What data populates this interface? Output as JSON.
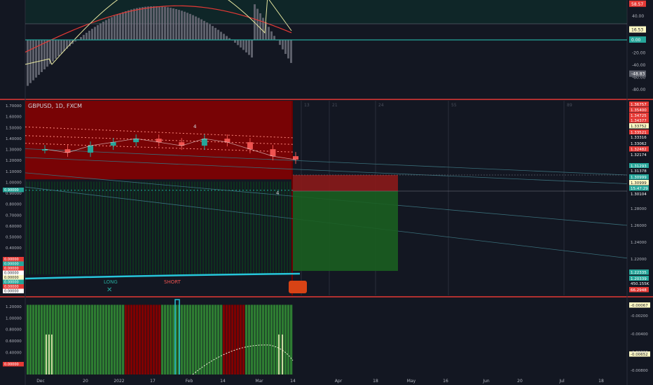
{
  "symbol": {
    "pair": "GBPUSD",
    "timeframe": "1D",
    "source": "FXCM"
  },
  "panes": {
    "top": {
      "badges": [
        {
          "label": "58.57",
          "color": "#e53935",
          "value": 58.57
        },
        {
          "label": "16.53",
          "color": "#fff9c4",
          "value": 16.53
        },
        {
          "label": "0.00",
          "color": "#26a69a",
          "value": 0
        }
      ],
      "badge_value2": {
        "label": "-48.83",
        "value": -48.83
      },
      "ticks": [
        {
          "label": "60.00",
          "value": 60
        },
        {
          "label": "40.00",
          "value": 40
        },
        {
          "label": "20.00",
          "value": 20
        },
        {
          "label": "0.00",
          "value": 0
        },
        {
          "label": "-20.00",
          "value": -20
        },
        {
          "label": "-40.00",
          "value": -40
        },
        {
          "label": "-60.00",
          "value": -60
        },
        {
          "label": "-80.00",
          "value": -80
        }
      ]
    },
    "main": {
      "left_ticks": [
        "1.70000",
        "1.60000",
        "1.50000",
        "1.40000",
        "1.30000",
        "1.20000",
        "1.10000",
        "1.00000",
        "0.90000",
        "0.80000",
        "0.70000",
        "0.60000",
        "0.50000",
        "0.40000",
        "0.30000",
        "0.20000",
        "0.10000"
      ],
      "left_badges": [
        {
          "label": "0.90000",
          "color": "#26a69a"
        },
        {
          "label": "0.00000",
          "color": "#e53935"
        },
        {
          "label": "0.00000",
          "color": "#26a69a"
        },
        {
          "label": "0.00000",
          "color": "#e53935"
        },
        {
          "label": "0.00000",
          "color": "#ffffff"
        },
        {
          "label": "0.00000",
          "color": "#fff9c4"
        },
        {
          "label": "0.00000",
          "color": "#26a69a"
        },
        {
          "label": "0.00000",
          "color": "#e53935"
        },
        {
          "label": "0.00000",
          "color": "#ffffff"
        }
      ],
      "right_ticks": [
        {
          "label": "1.28000"
        },
        {
          "label": "1.26000"
        },
        {
          "label": "1.24000"
        },
        {
          "label": "1.22000"
        }
      ],
      "right_badges": [
        {
          "label": "1.36757",
          "color": "#e53935"
        },
        {
          "label": "1.35400",
          "color": "#e53935"
        },
        {
          "label": "1.34725",
          "color": "#e53935"
        },
        {
          "label": "1.34377",
          "color": "#e53935"
        },
        {
          "label": "1.33752",
          "color": "#fff9c4"
        },
        {
          "label": "1.33521",
          "color": "#e53935"
        },
        {
          "label": "1.33316",
          "color": "#131722"
        },
        {
          "label": "1.33062",
          "color": "#131722"
        },
        {
          "label": "1.32482",
          "color": "#e53935"
        },
        {
          "label": "1.32174",
          "color": "#131722"
        },
        {
          "label": "1.31293",
          "color": "#26a69a"
        },
        {
          "label": "1.31378",
          "color": "#131722"
        },
        {
          "label": "1.30999",
          "color": "#26a69a"
        },
        {
          "label": "1.30999",
          "color": "#fff9c4"
        },
        {
          "label": "15:47:29",
          "color": "#26a69a"
        },
        {
          "label": "1.30104",
          "color": "#131722"
        },
        {
          "label": "1.22335",
          "color": "#26a69a"
        },
        {
          "label": "1.20339",
          "color": "#26a69a"
        },
        {
          "label": "450.155K",
          "color": "#131722"
        },
        {
          "label": "66.2948",
          "color": "#e53935"
        }
      ],
      "annotations": {
        "long": "LONG",
        "short": "SHORT",
        "marker": "4"
      },
      "grid_labels": [
        "13",
        "21",
        "24",
        "55",
        "89"
      ]
    },
    "bottom": {
      "left_ticks": [
        "1.20000",
        "1.00000",
        "0.80000",
        "0.60000",
        "0.40000",
        "0.20000"
      ],
      "left_badge": "0.00000",
      "right_badges": [
        {
          "label": "-0.00067",
          "color": "#fff9c4"
        },
        {
          "label": "-0.00652",
          "color": "#fff9c4"
        }
      ],
      "right_ticks": [
        "-0.00200",
        "-0.00400",
        "-0.00600",
        "-0.00800"
      ]
    }
  },
  "x_axis": [
    "Dec",
    "20",
    "2022",
    "17",
    "Feb",
    "14",
    "Mar",
    "14",
    "Apr",
    "18",
    "May",
    "16",
    "Jun",
    "20",
    "Jul",
    "18"
  ],
  "colors": {
    "up": "#26a69a",
    "down": "#ef5350",
    "bg": "#131722",
    "grid": "#2a2e39"
  },
  "chart_data": {
    "type": "line",
    "title": "GBPUSD, 1D, FXCM",
    "series": [
      {
        "name": "GBPUSD",
        "values": [
          1.33,
          1.32,
          1.34,
          1.35,
          1.36,
          1.35,
          1.34,
          1.36,
          1.35,
          1.33,
          1.31,
          1.3
        ]
      }
    ],
    "x": [
      "Dec",
      "20",
      "2022",
      "17",
      "Feb",
      "14",
      "Mar",
      "14"
    ]
  }
}
